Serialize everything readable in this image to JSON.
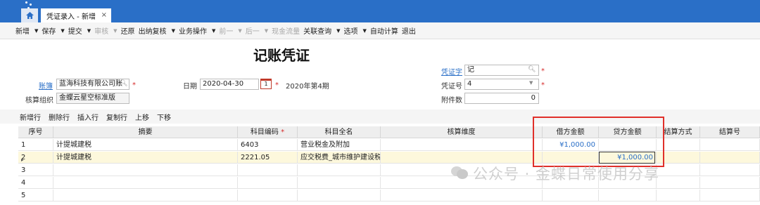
{
  "tabs": {
    "home_icon": "home-icon",
    "active": "凭证录入 - 新增",
    "close": "×"
  },
  "toolbar": [
    {
      "label": "新增",
      "arrow": true,
      "disabled": false
    },
    {
      "label": "保存",
      "arrow": true,
      "disabled": false
    },
    {
      "label": "提交",
      "arrow": true,
      "disabled": false
    },
    {
      "label": "审核",
      "arrow": true,
      "disabled": true
    },
    {
      "label": "还原",
      "arrow": false,
      "disabled": false
    },
    {
      "label": "出纳复核",
      "arrow": true,
      "disabled": false
    },
    {
      "label": "业务操作",
      "arrow": true,
      "disabled": false
    },
    {
      "label": "前一",
      "arrow": true,
      "disabled": true
    },
    {
      "label": "后一",
      "arrow": true,
      "disabled": true
    },
    {
      "label": "现金流量",
      "arrow": false,
      "disabled": true
    },
    {
      "label": "关联查询",
      "arrow": true,
      "disabled": false
    },
    {
      "label": "选项",
      "arrow": true,
      "disabled": false
    },
    {
      "label": "自动计算",
      "arrow": false,
      "disabled": false
    },
    {
      "label": "退出",
      "arrow": false,
      "disabled": false
    }
  ],
  "voucher": {
    "title": "记账凭证",
    "book_label": "账簿",
    "book_value": "蓝海科技有限公司账",
    "org_label": "核算组织",
    "org_value": "金蝶云星空标准版",
    "date_label": "日期",
    "date_value": "2020-04-30",
    "cal_text": "1",
    "period_text": "2020年第4期",
    "word_label": "凭证字",
    "word_value": "记",
    "number_label": "凭证号",
    "number_value": "4",
    "attach_label": "附件数",
    "attach_value": "0",
    "required_mark": "*"
  },
  "entry_toolbar": [
    "新增行",
    "删除行",
    "插入行",
    "复制行",
    "上移",
    "下移"
  ],
  "grid": {
    "headers": [
      "序号",
      "摘要",
      "科目编码",
      "科目全名",
      "核算维度",
      "借方金额",
      "贷方金额",
      "结算方式",
      "结算号"
    ],
    "rows": [
      {
        "no": "1",
        "summary": "计提城建税",
        "code": "6403",
        "name": "营业税金及附加",
        "dim": "",
        "debit": "¥1,000.00",
        "credit": "",
        "method": "",
        "num": ""
      },
      {
        "no": "2",
        "summary": "计提城建税",
        "code": "2221.05",
        "name": "应交税费_城市维护建设税",
        "dim": "",
        "debit": "",
        "credit": "¥1,000.00",
        "method": "",
        "num": ""
      },
      {
        "no": "3",
        "summary": "",
        "code": "",
        "name": "",
        "dim": "",
        "debit": "",
        "credit": "",
        "method": "",
        "num": ""
      },
      {
        "no": "4",
        "summary": "",
        "code": "",
        "name": "",
        "dim": "",
        "debit": "",
        "credit": "",
        "method": "",
        "num": ""
      },
      {
        "no": "5",
        "summary": "",
        "code": "",
        "name": "",
        "dim": "",
        "debit": "",
        "credit": "",
        "method": "",
        "num": ""
      }
    ],
    "selected_row_marker": "▸"
  },
  "watermark": "公众号 · 金蝶日常使用分享",
  "colors": {
    "header_blue": "#2a6fc7",
    "highlight_red": "#e0302a",
    "selected_row": "#fdf8dc"
  }
}
